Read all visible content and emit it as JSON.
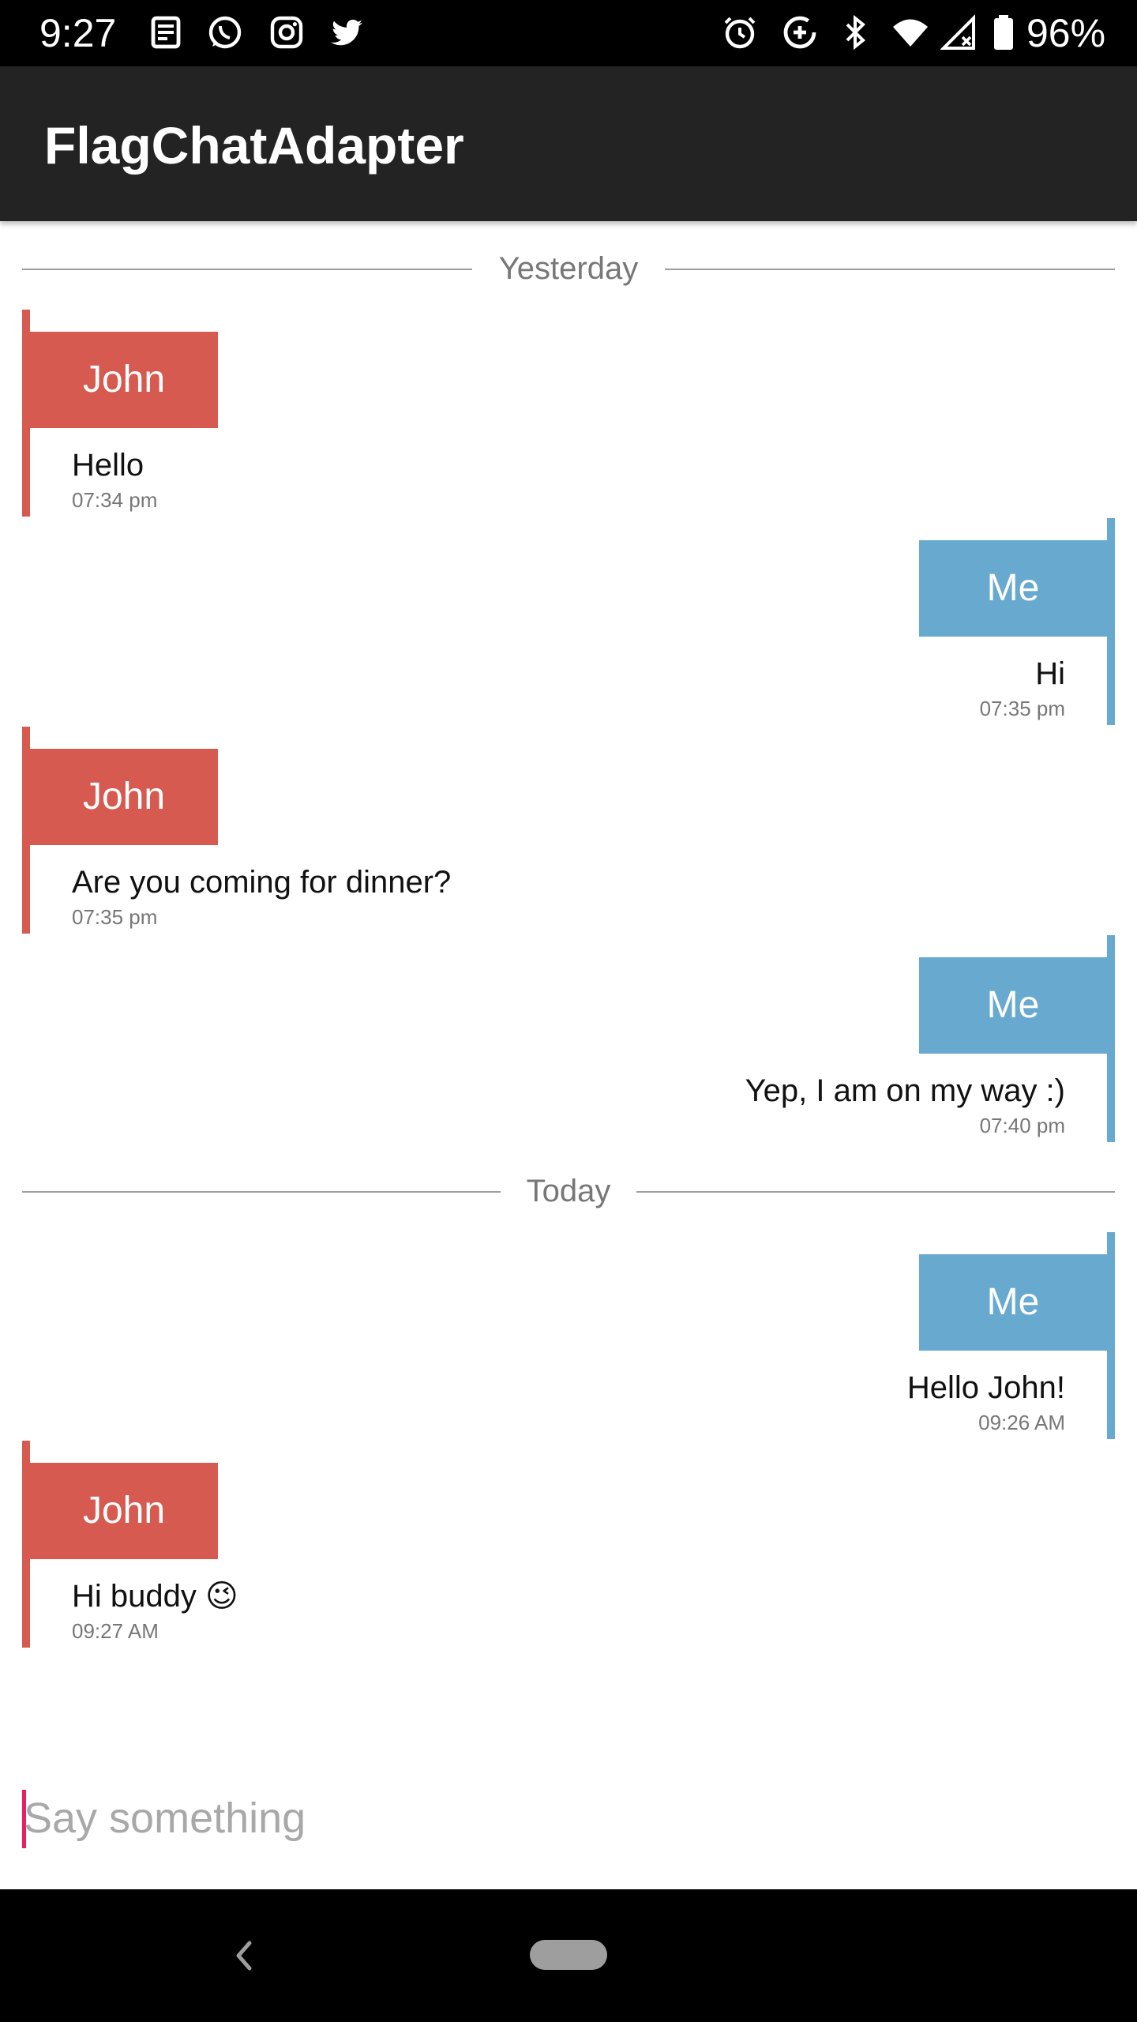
{
  "status_bar": {
    "time": "9:27",
    "battery": "96%",
    "left_icons": [
      "news-icon",
      "whatsapp-icon",
      "instagram-icon",
      "twitter-icon"
    ],
    "right_icons": [
      "alarm-icon",
      "data-saver-icon",
      "bluetooth-icon",
      "wifi-icon",
      "signal-icon",
      "battery-icon"
    ]
  },
  "app_bar": {
    "title": "FlagChatAdapter"
  },
  "colors": {
    "john": "#d65a50",
    "me": "#67a9cf",
    "app_bar": "#232323",
    "cursor": "#e91e63"
  },
  "chat": {
    "separators": [
      {
        "label": "Yesterday"
      },
      {
        "label": "Today"
      }
    ],
    "messages": [
      {
        "sender": "John",
        "text": "Hello",
        "time": "07:34 pm",
        "side": "left"
      },
      {
        "sender": "Me",
        "text": "Hi",
        "time": "07:35 pm",
        "side": "right"
      },
      {
        "sender": "John",
        "text": "Are you coming for dinner?",
        "time": "07:35 pm",
        "side": "left"
      },
      {
        "sender": "Me",
        "text": "Yep, I am on my way :)",
        "time": "07:40 pm",
        "side": "right"
      },
      {
        "sender": "Me",
        "text": "Hello John!",
        "time": "09:26 AM",
        "side": "right"
      },
      {
        "sender": "John",
        "text": "Hi buddy 😉",
        "time": "09:27 AM",
        "side": "left"
      }
    ]
  },
  "input": {
    "placeholder": "Say something",
    "value": ""
  },
  "nav_bar": {
    "icons": [
      "back-icon",
      "home-pill-icon"
    ]
  }
}
